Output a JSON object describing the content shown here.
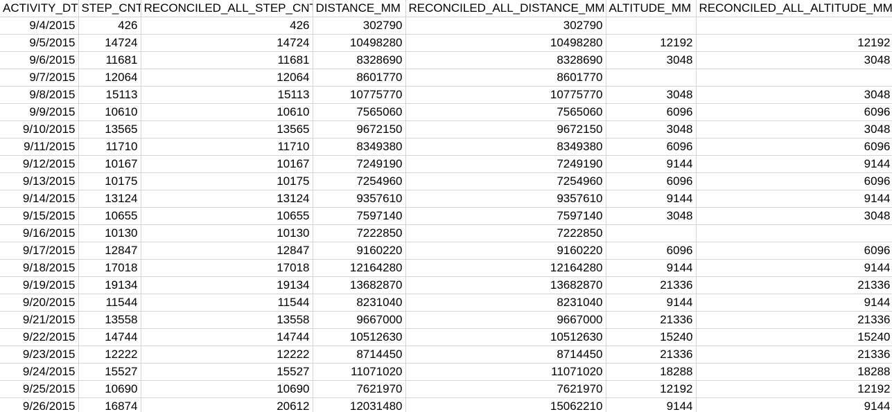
{
  "sheet": {
    "headers": [
      "ACTIVITY_DT",
      "STEP_CNT",
      "RECONCILED_ALL_STEP_CNT",
      "DISTANCE_MM",
      "RECONCILED_ALL_DISTANCE_MM",
      "ALTITUDE_MM",
      "RECONCILED_ALL_ALTITUDE_MM"
    ],
    "rows": [
      [
        "9/4/2015",
        "426",
        "426",
        "302790",
        "302790",
        "",
        ""
      ],
      [
        "9/5/2015",
        "14724",
        "14724",
        "10498280",
        "10498280",
        "12192",
        "12192"
      ],
      [
        "9/6/2015",
        "11681",
        "11681",
        "8328690",
        "8328690",
        "3048",
        "3048"
      ],
      [
        "9/7/2015",
        "12064",
        "12064",
        "8601770",
        "8601770",
        "",
        ""
      ],
      [
        "9/8/2015",
        "15113",
        "15113",
        "10775770",
        "10775770",
        "3048",
        "3048"
      ],
      [
        "9/9/2015",
        "10610",
        "10610",
        "7565060",
        "7565060",
        "6096",
        "6096"
      ],
      [
        "9/10/2015",
        "13565",
        "13565",
        "9672150",
        "9672150",
        "3048",
        "3048"
      ],
      [
        "9/11/2015",
        "11710",
        "11710",
        "8349380",
        "8349380",
        "6096",
        "6096"
      ],
      [
        "9/12/2015",
        "10167",
        "10167",
        "7249190",
        "7249190",
        "9144",
        "9144"
      ],
      [
        "9/13/2015",
        "10175",
        "10175",
        "7254960",
        "7254960",
        "6096",
        "6096"
      ],
      [
        "9/14/2015",
        "13124",
        "13124",
        "9357610",
        "9357610",
        "9144",
        "9144"
      ],
      [
        "9/15/2015",
        "10655",
        "10655",
        "7597140",
        "7597140",
        "3048",
        "3048"
      ],
      [
        "9/16/2015",
        "10130",
        "10130",
        "7222850",
        "7222850",
        "",
        ""
      ],
      [
        "9/17/2015",
        "12847",
        "12847",
        "9160220",
        "9160220",
        "6096",
        "6096"
      ],
      [
        "9/18/2015",
        "17018",
        "17018",
        "12164280",
        "12164280",
        "9144",
        "9144"
      ],
      [
        "9/19/2015",
        "19134",
        "19134",
        "13682870",
        "13682870",
        "21336",
        "21336"
      ],
      [
        "9/20/2015",
        "11544",
        "11544",
        "8231040",
        "8231040",
        "9144",
        "9144"
      ],
      [
        "9/21/2015",
        "13558",
        "13558",
        "9667000",
        "9667000",
        "21336",
        "21336"
      ],
      [
        "9/22/2015",
        "14744",
        "14744",
        "10512630",
        "10512630",
        "15240",
        "15240"
      ],
      [
        "9/23/2015",
        "12222",
        "12222",
        "8714450",
        "8714450",
        "21336",
        "21336"
      ],
      [
        "9/24/2015",
        "15527",
        "15527",
        "11071020",
        "11071020",
        "18288",
        "18288"
      ],
      [
        "9/25/2015",
        "10690",
        "10690",
        "7621970",
        "7621970",
        "12192",
        "12192"
      ],
      [
        "9/26/2015",
        "16874",
        "20612",
        "12031480",
        "15062210",
        "9144",
        "9144"
      ]
    ]
  }
}
